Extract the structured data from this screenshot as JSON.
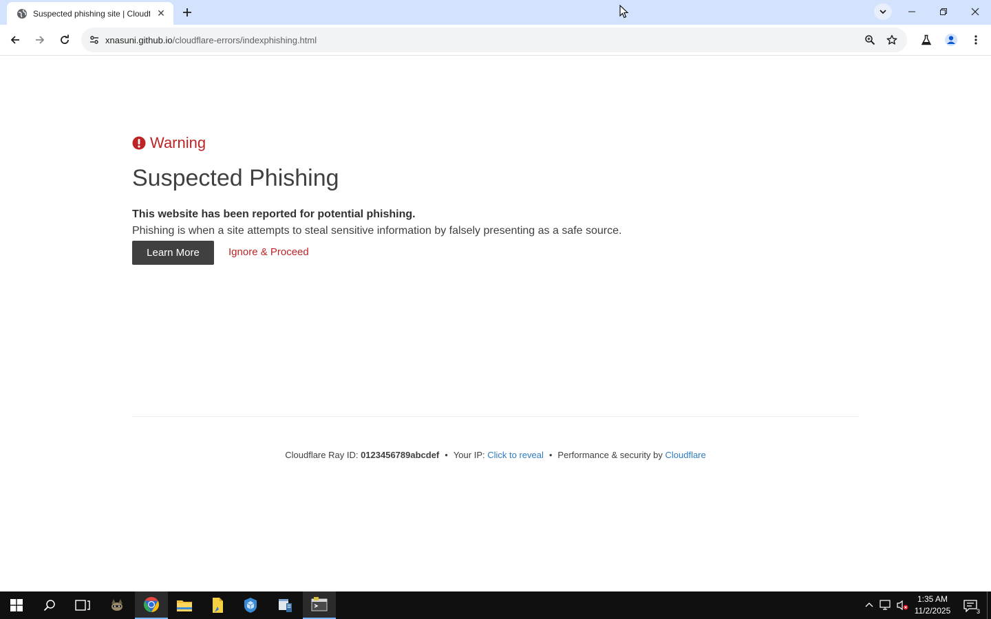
{
  "browser": {
    "tab": {
      "title": "Suspected phishing site | Cloudf",
      "close_label": "✕"
    },
    "url": {
      "host": "xnasuni.github.io",
      "path": "/cloudflare-errors/indexphishing.html"
    }
  },
  "page": {
    "warning_label": "Warning",
    "headline": "Suspected Phishing",
    "lead_bold": "This website has been reported for potential phishing.",
    "lead_text": "Phishing is when a site attempts to steal sensitive information by falsely presenting as a safe source.",
    "learn_more_label": "Learn More",
    "proceed_label": "Ignore & Proceed",
    "footer": {
      "ray_label": "Cloudflare Ray ID: ",
      "ray_id": "0123456789abcdef",
      "bullet": "•",
      "ip_label": "Your IP: ",
      "ip_link": "Click to reveal",
      "perf_label": "Performance & security by ",
      "perf_link": "Cloudflare"
    }
  },
  "taskbar": {
    "time": "1:35 AM",
    "date": "11/2/2025",
    "notification_count": "3"
  },
  "colors": {
    "accent_red": "#bd2426",
    "link_blue": "#2f7bbf",
    "button_dark": "#404040",
    "chrome_blue": "#d3e3fd"
  }
}
